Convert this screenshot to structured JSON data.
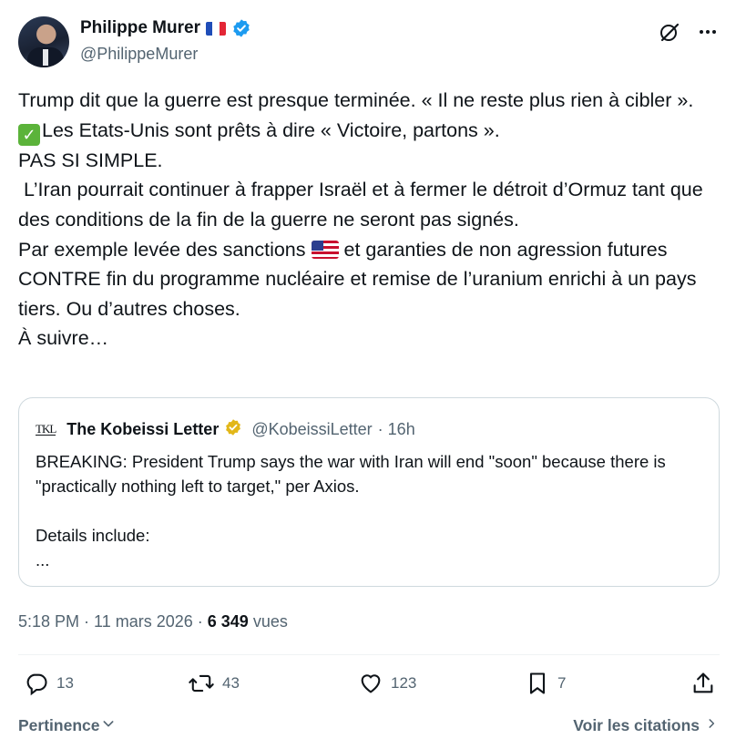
{
  "author": {
    "name": "Philippe Murer",
    "handle": "@PhilippeMurer",
    "flag_icon": "france-flag-icon",
    "verified_icon": "verified-badge-icon",
    "verified_color": "#1d9bf0"
  },
  "post": {
    "lines": [
      "Trump dit que la guerre est presque terminée. « Il ne reste plus rien à cibler ».",
      "Les Etats-Unis sont prêts à dire « Victoire, partons ».",
      "PAS SI SIMPLE.",
      " L’Iran pourrait continuer à frapper Israël et à fermer le détroit d’Ormuz tant que des conditions de la fin de la guerre ne seront pas signés.",
      "Par exemple levée des sanctions",
      "et garanties de non agression futures CONTRE fin du programme nucléaire et remise de l’uranium enrichi à un pays tiers. Ou d’autres choses.",
      "À suivre…"
    ]
  },
  "quote": {
    "logo": "TKL",
    "name": "The Kobeissi Letter",
    "handle": "@KobeissiLetter",
    "time": "· 16h",
    "text": "BREAKING: President Trump says the war with Iran will end \"soon\" because there is \"practically nothing left to target,\" per Axios.\n\nDetails include:\n...",
    "verified_color": "#e2b719"
  },
  "meta": {
    "time_date": "5:18 PM · 11 mars 2026 · ",
    "views_count": "6 349",
    "views_label": " vues"
  },
  "actions": {
    "replies": "13",
    "reposts": "43",
    "likes": "123",
    "bookmarks": "7"
  },
  "footer": {
    "sort_label": "Pertinence",
    "quotes_label": "Voir les citations"
  }
}
